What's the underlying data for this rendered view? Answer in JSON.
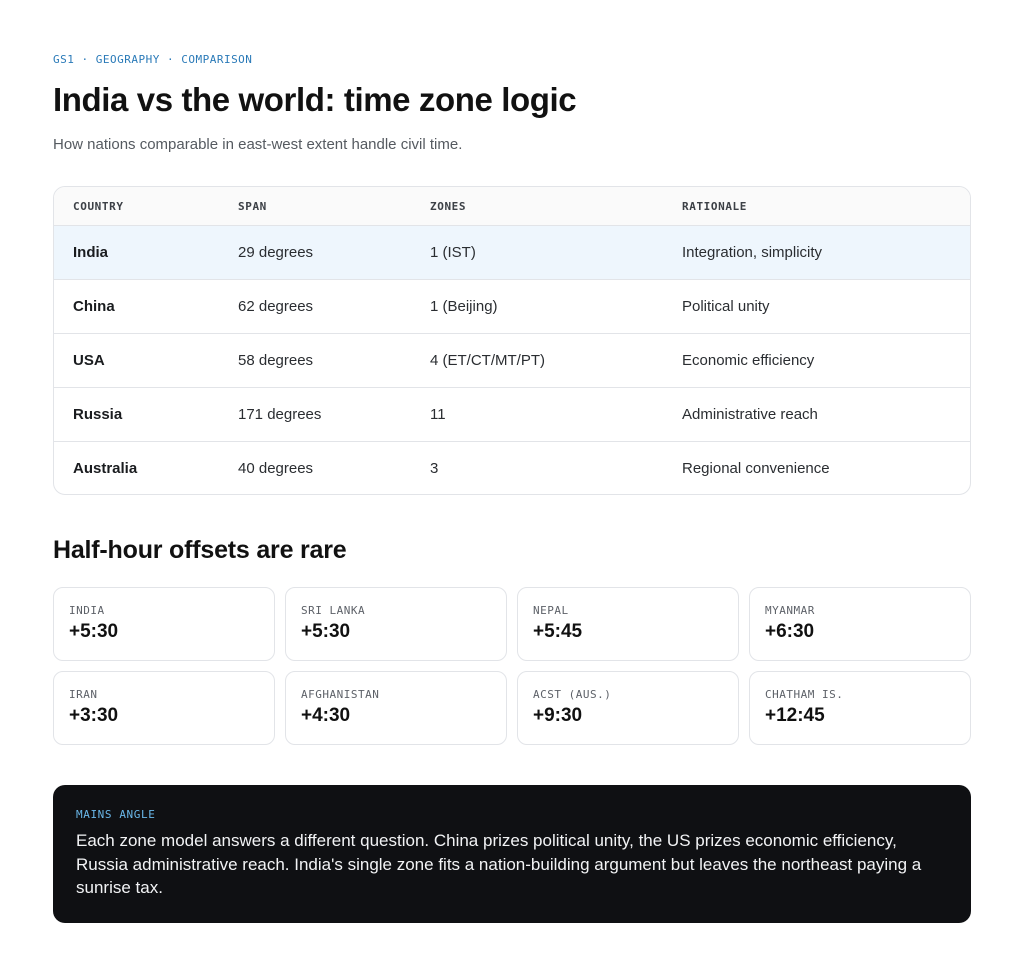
{
  "header": {
    "eyebrow": "GS1 · GEOGRAPHY · COMPARISON",
    "title": "India vs the world: time zone logic",
    "subtitle": "How nations comparable in east-west extent handle civil time."
  },
  "table": {
    "columns": [
      "COUNTRY",
      "SPAN",
      "ZONES",
      "RATIONALE"
    ],
    "rows": [
      {
        "country": "India",
        "span": "29 degrees",
        "zones": "1 (IST)",
        "rationale": "Integration, simplicity"
      },
      {
        "country": "China",
        "span": "62 degrees",
        "zones": "1 (Beijing)",
        "rationale": "Political unity"
      },
      {
        "country": "USA",
        "span": "58 degrees",
        "zones": "4 (ET/CT/MT/PT)",
        "rationale": "Economic efficiency"
      },
      {
        "country": "Russia",
        "span": "171 degrees",
        "zones": "11",
        "rationale": "Administrative reach"
      },
      {
        "country": "Australia",
        "span": "40 degrees",
        "zones": "3",
        "rationale": "Regional convenience"
      }
    ]
  },
  "offsets": {
    "title": "Half-hour offsets are rare",
    "items": [
      {
        "label": "INDIA",
        "value": "+5:30"
      },
      {
        "label": "SRI LANKA",
        "value": "+5:30"
      },
      {
        "label": "NEPAL",
        "value": "+5:45"
      },
      {
        "label": "MYANMAR",
        "value": "+6:30"
      },
      {
        "label": "IRAN",
        "value": "+3:30"
      },
      {
        "label": "AFGHANISTAN",
        "value": "+4:30"
      },
      {
        "label": "ACST (AUS.)",
        "value": "+9:30"
      },
      {
        "label": "CHATHAM IS.",
        "value": "+12:45"
      }
    ]
  },
  "callout": {
    "label": "MAINS ANGLE",
    "text": "Each zone model answers a different question. China prizes political unity, the US prizes economic efficiency, Russia administrative reach. India's single zone fits a nation-building argument but leaves the northeast paying a sunrise tax."
  },
  "colors": {
    "accent": "#2a7ab8",
    "highlight_row": "#eef6fd",
    "callout_bg": "#0f1013",
    "callout_label": "#6ab8ea"
  }
}
